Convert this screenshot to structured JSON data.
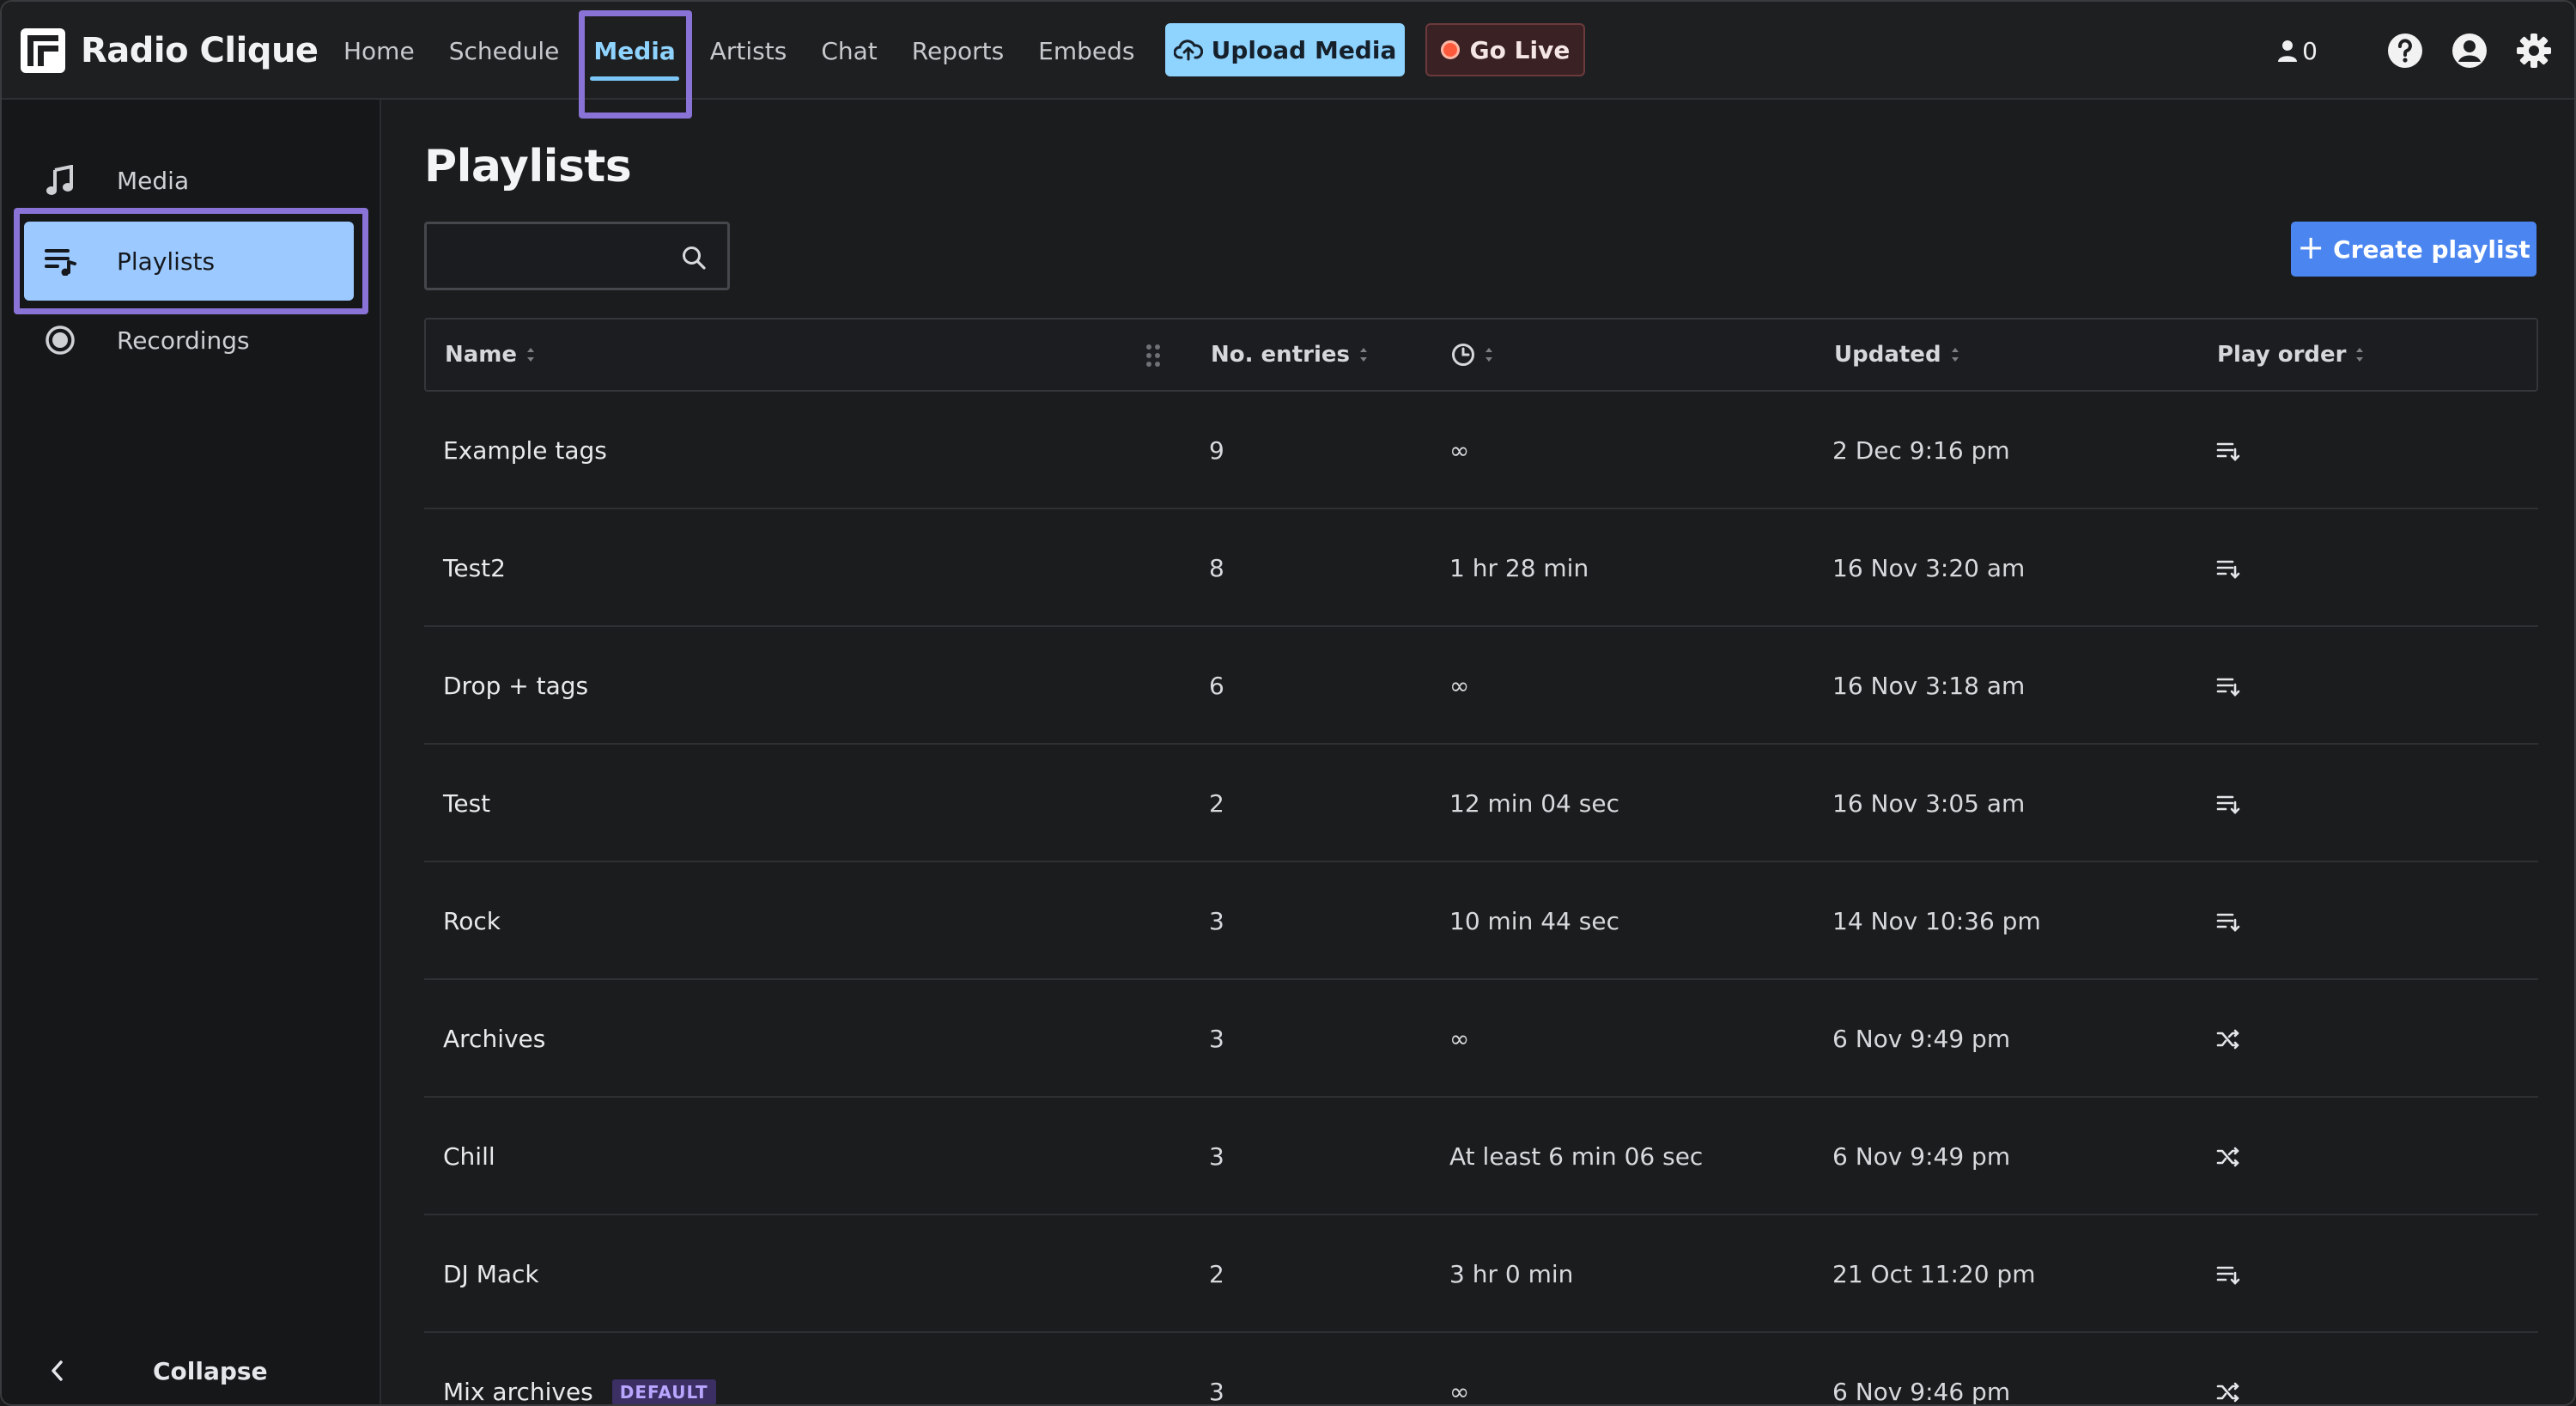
{
  "app": {
    "name": "Radio Clique"
  },
  "nav": {
    "items": [
      {
        "label": "Home",
        "active": false
      },
      {
        "label": "Schedule",
        "active": false
      },
      {
        "label": "Media",
        "active": true
      },
      {
        "label": "Artists",
        "active": false
      },
      {
        "label": "Chat",
        "active": false
      },
      {
        "label": "Reports",
        "active": false
      },
      {
        "label": "Embeds",
        "active": false
      }
    ],
    "upload_label": "Upload Media",
    "live_label": "Go Live",
    "listener_count": "0"
  },
  "sidebar": {
    "items": [
      {
        "label": "Media",
        "icon": "music-note-icon",
        "active": false
      },
      {
        "label": "Playlists",
        "icon": "playlist-icon",
        "active": true
      },
      {
        "label": "Recordings",
        "icon": "record-icon",
        "active": false
      }
    ],
    "collapse_label": "Collapse"
  },
  "main": {
    "title": "Playlists",
    "search": {
      "value": "",
      "placeholder": ""
    },
    "create_label": "Create playlist",
    "columns": {
      "name": "Name",
      "entries": "No. entries",
      "duration_icon": "clock-icon",
      "updated": "Updated",
      "play_order": "Play order"
    },
    "rows": [
      {
        "name": "Example tags",
        "entries": "9",
        "duration": "∞",
        "updated": "2 Dec 9:16 pm",
        "order": "sequential-icon",
        "badge": ""
      },
      {
        "name": "Test2",
        "entries": "8",
        "duration": "1 hr 28 min",
        "updated": "16 Nov 3:20 am",
        "order": "sequential-icon",
        "badge": ""
      },
      {
        "name": "Drop + tags",
        "entries": "6",
        "duration": "∞",
        "updated": "16 Nov 3:18 am",
        "order": "sequential-icon",
        "badge": ""
      },
      {
        "name": "Test",
        "entries": "2",
        "duration": "12 min 04 sec",
        "updated": "16 Nov 3:05 am",
        "order": "sequential-icon",
        "badge": ""
      },
      {
        "name": "Rock",
        "entries": "3",
        "duration": "10 min 44 sec",
        "updated": "14 Nov 10:36 pm",
        "order": "sequential-icon",
        "badge": ""
      },
      {
        "name": "Archives",
        "entries": "3",
        "duration": "∞",
        "updated": "6 Nov 9:49 pm",
        "order": "shuffle-icon",
        "badge": ""
      },
      {
        "name": "Chill",
        "entries": "3",
        "duration": "At least 6 min 06 sec",
        "updated": "6 Nov 9:49 pm",
        "order": "shuffle-icon",
        "badge": ""
      },
      {
        "name": "DJ Mack",
        "entries": "2",
        "duration": "3 hr 0 min",
        "updated": "21 Oct 11:20 pm",
        "order": "sequential-icon",
        "badge": ""
      },
      {
        "name": "Mix archives",
        "entries": "3",
        "duration": "∞",
        "updated": "6 Nov 9:46 pm",
        "order": "shuffle-icon",
        "badge": "DEFAULT"
      }
    ]
  },
  "colors": {
    "accent": "#8fd3ff",
    "sidebar_active": "#9cc9ff",
    "highlight": "#8a73d6",
    "create_button": "#4b86f0",
    "live_dot": "#ff5a3c"
  }
}
